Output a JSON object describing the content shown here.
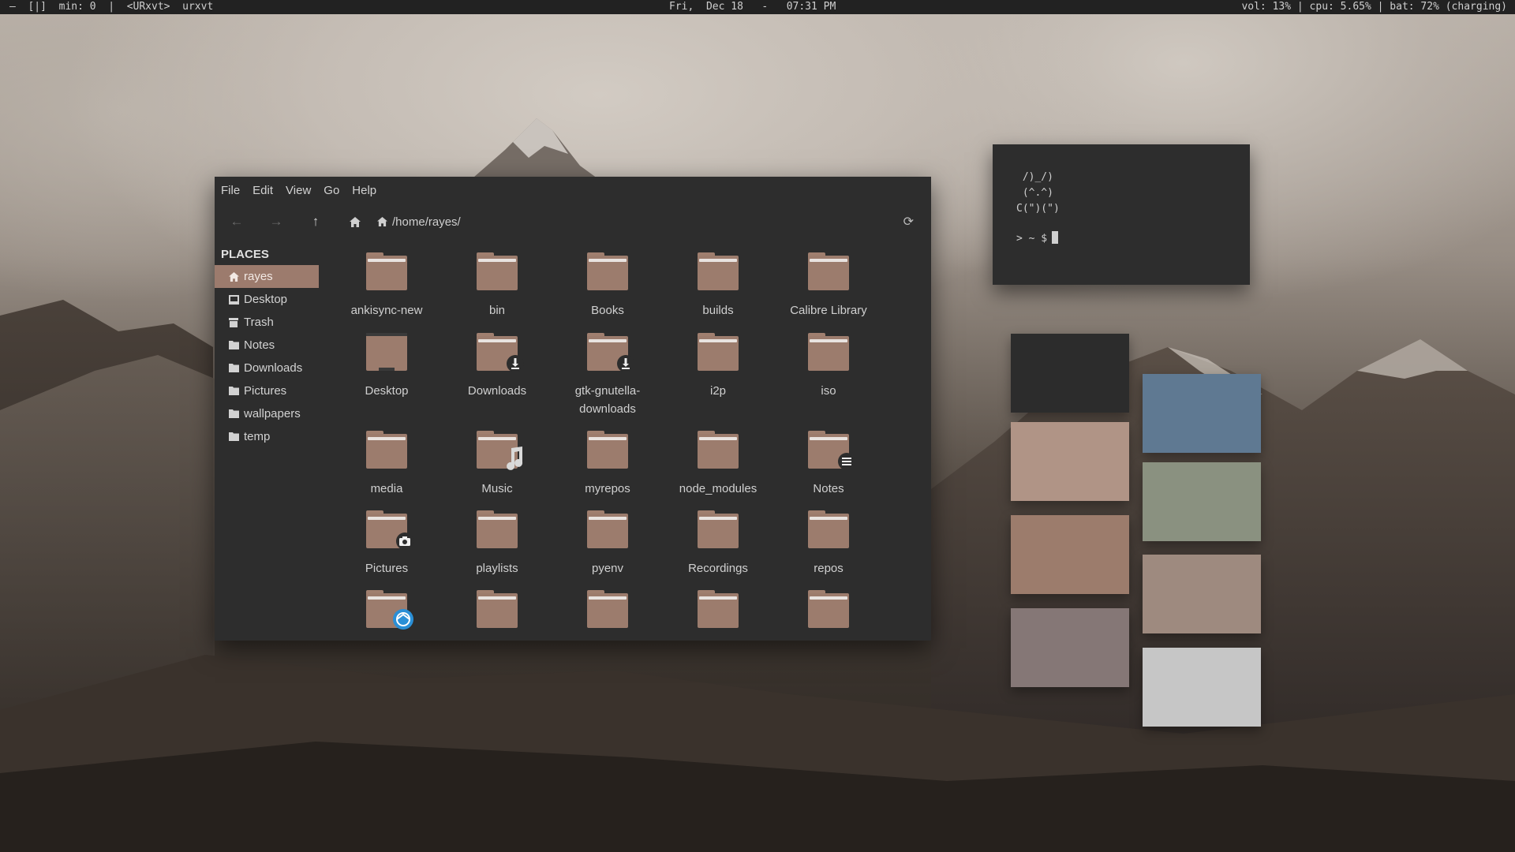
{
  "topbar": {
    "left": "—  [|]  min: 0  |  <URxvt>  urxvt",
    "center": "Fri,  Dec 18   -   07:31 PM",
    "right": "vol: 13% | cpu: 5.65% | bat: 72% (charging)"
  },
  "file_manager": {
    "menu": [
      "File",
      "Edit",
      "View",
      "Go",
      "Help"
    ],
    "toolbar": {
      "back_icon": "arrow-left-icon",
      "forward_icon": "arrow-right-icon",
      "up_icon": "arrow-up-icon",
      "home_icon": "home-icon",
      "reload_icon": "reload-icon"
    },
    "path": "/home/rayes/",
    "sidebar": {
      "heading": "PLACES",
      "items": [
        {
          "label": "rayes",
          "icon": "home-icon",
          "active": true
        },
        {
          "label": "Desktop",
          "icon": "desktop-icon"
        },
        {
          "label": "Trash",
          "icon": "trash-icon"
        },
        {
          "label": "Notes",
          "icon": "folder-icon"
        },
        {
          "label": "Downloads",
          "icon": "folder-icon"
        },
        {
          "label": "Pictures",
          "icon": "folder-icon"
        },
        {
          "label": "wallpapers",
          "icon": "folder-icon"
        },
        {
          "label": "temp",
          "icon": "folder-icon"
        }
      ]
    },
    "folders": [
      {
        "name": "ankisync-new"
      },
      {
        "name": "bin"
      },
      {
        "name": "Books"
      },
      {
        "name": "builds"
      },
      {
        "name": "Calibre Library"
      },
      {
        "name": "Desktop",
        "variant": "desktop"
      },
      {
        "name": "Downloads",
        "overlay": "download-icon"
      },
      {
        "name": "gtk-gnutella-\ndownloads",
        "overlay": "download-icon"
      },
      {
        "name": "i2p"
      },
      {
        "name": "iso"
      },
      {
        "name": "media"
      },
      {
        "name": "Music",
        "overlay": "music-note-icon"
      },
      {
        "name": "myrepos"
      },
      {
        "name": "node_modules"
      },
      {
        "name": "Notes",
        "overlay": "list-icon"
      },
      {
        "name": "Pictures",
        "overlay": "camera-icon"
      },
      {
        "name": "playlists"
      },
      {
        "name": "pyenv"
      },
      {
        "name": "Recordings"
      },
      {
        "name": "repos"
      },
      {
        "name": "",
        "overlay": "sync-icon"
      },
      {
        "name": ""
      },
      {
        "name": ""
      },
      {
        "name": ""
      },
      {
        "name": ""
      }
    ],
    "colors": {
      "folder": "#9c7c6d",
      "selection": "#9c7b6d",
      "window_bg": "#2d2d2d"
    }
  },
  "terminal": {
    "art": " /)_/)\n (^.^)\nC(\")(\")",
    "prompt": "> ~ $"
  },
  "palette": {
    "left_column": [
      "#2c2c2c",
      "#b09486",
      "#9c7c6c",
      "#857776"
    ],
    "right_column": [
      "#5f7992",
      "#8a9180",
      "#9e8a7f",
      "#c6c6c6"
    ]
  }
}
